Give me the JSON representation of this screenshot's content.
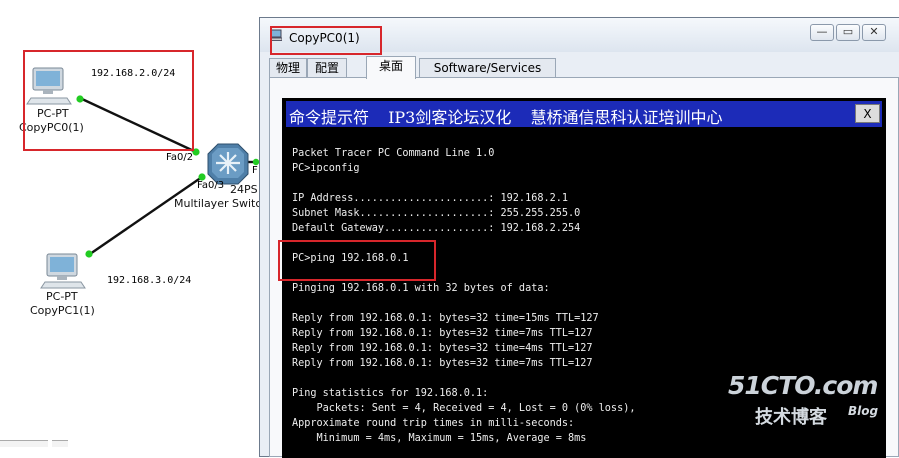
{
  "topology": {
    "pc0": {
      "type": "PC-PT",
      "name": "CopyPC0(1)",
      "network": "192.168.2.0/24"
    },
    "pc1": {
      "type": "PC-PT",
      "name": "CopyPC1(1)",
      "network": "192.168.3.0/24"
    },
    "switch": {
      "label_partial": "24PS",
      "label_line2": "Multilayer Switc",
      "port_pc0": "Fa0/2",
      "port_pc1": "Fa0/3",
      "port_right": "F"
    }
  },
  "window": {
    "title": "CopyPC0(1)",
    "tabs": [
      "物理",
      "配置",
      "桌面",
      "Software/Services"
    ],
    "active_tab": "桌面",
    "buttons": {
      "minimize": "—",
      "restore": "▭",
      "close": "✕"
    }
  },
  "cmd": {
    "title": "命令提示符 IP3剑客论坛汉化 慧桥通信思科认证培训中心",
    "title_parts": [
      "命令提示符",
      "IP3剑客论坛汉化",
      "慧桥通信思科认证培训中心"
    ],
    "close_label": "X",
    "lines": [
      "Packet Tracer PC Command Line 1.0",
      "PC>ipconfig",
      "",
      "IP Address......................: 192.168.2.1",
      "Subnet Mask.....................: 255.255.255.0",
      "Default Gateway.................: 192.168.2.254",
      "",
      "PC>ping 192.168.0.1",
      "",
      "Pinging 192.168.0.1 with 32 bytes of data:",
      "",
      "Reply from 192.168.0.1: bytes=32 time=15ms TTL=127",
      "Reply from 192.168.0.1: bytes=32 time=7ms TTL=127",
      "Reply from 192.168.0.1: bytes=32 time=4ms TTL=127",
      "Reply from 192.168.0.1: bytes=32 time=7ms TTL=127",
      "",
      "Ping statistics for 192.168.0.1:",
      "    Packets: Sent = 4, Received = 4, Lost = 0 (0% loss),",
      "Approximate round trip times in milli-seconds:",
      "    Minimum = 4ms, Maximum = 15ms, Average = 8ms"
    ]
  },
  "watermark": {
    "site": "51CTO.com",
    "sub": "技术博客",
    "blog": "Blog"
  },
  "colors": {
    "highlight_red": "#d7262b",
    "cmd_titlebar": "#1c2bb8",
    "link_green": "#22cc22"
  }
}
